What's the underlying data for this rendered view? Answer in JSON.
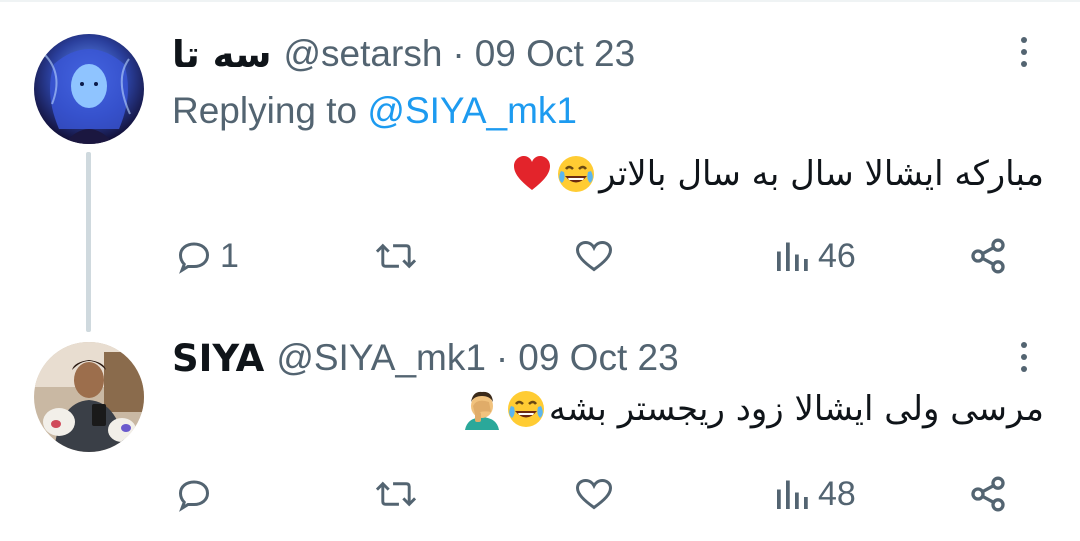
{
  "tweets": [
    {
      "display_name": "سه تا",
      "handle": "@setarsh",
      "separator": "·",
      "date": "09 Oct 23",
      "replying_prefix": "Replying to",
      "replying_mention": "@SIYA_mk1",
      "body": "مبارکه ایشالا سال به سال بالاتر",
      "emojis": [
        "face-with-tears-of-joy",
        "red-heart"
      ],
      "actions": {
        "replies": "1",
        "retweets": "",
        "likes": "",
        "views": "46"
      }
    },
    {
      "display_name": "SIYA",
      "handle": "@SIYA_mk1",
      "separator": "·",
      "date": "09 Oct 23",
      "body": "مرسی ولی ایشالا زود ریجستر بشه",
      "emojis": [
        "face-with-tears-of-joy",
        "man-facepalming"
      ],
      "actions": {
        "replies": "",
        "retweets": "",
        "likes": "",
        "views": "48"
      }
    }
  ],
  "colors": {
    "text": "#0f1419",
    "secondary": "#536471",
    "link": "#1d9bf0",
    "thread_line": "#cfd9de"
  },
  "icons": [
    "reply-icon",
    "retweet-icon",
    "like-icon",
    "views-icon",
    "share-icon",
    "more-icon"
  ]
}
